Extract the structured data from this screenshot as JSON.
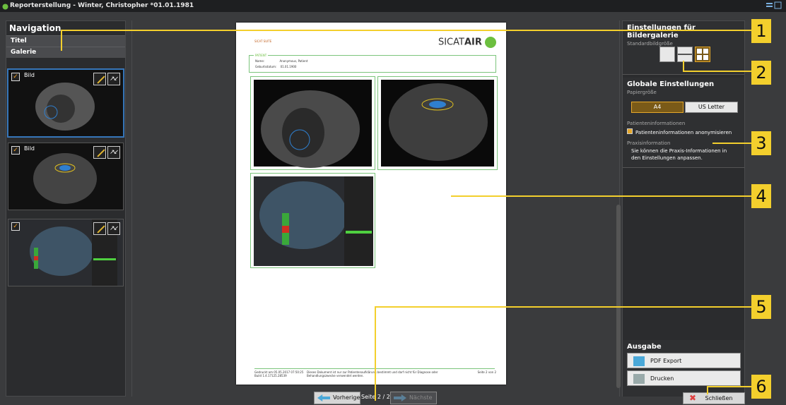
{
  "window": {
    "title": "Reporterstellung - Winter, Christopher *01.01.1981"
  },
  "navigation": {
    "title": "Navigation",
    "sections": [
      "Titel",
      "Galerie"
    ],
    "thumbnails": [
      {
        "label": "Bild",
        "checked": true,
        "selected": true
      },
      {
        "label": "Bild",
        "checked": true,
        "selected": false
      },
      {
        "label": "",
        "checked": true,
        "selected": false
      }
    ]
  },
  "document": {
    "brand_small": "SICAT SUITE",
    "brand": "SICAT",
    "brand_bold": "AIR",
    "patient_header": "PATIENT",
    "name_label": "Name:",
    "name_value": "Anonymous, Patient",
    "dob_label": "Geburtsdatum:",
    "dob_value": "01.01.1900",
    "footer_left": "Gedruckt am 05.05.2017 07:50:25\nBuild 1.4.17125.28539",
    "footer_mid": "Dieses Dokument ist nur zur Patientenaufklärung bestimmt und darf nicht für Diagnose oder Behandlungszwecke verwendet werden.",
    "footer_right": "Seite 2 von 2"
  },
  "pager": {
    "prev": "Vorherige",
    "page": "Seite 2 / 2",
    "next": "Nächste"
  },
  "gallery_settings": {
    "title": "Einstellungen für Bildergalerie",
    "subtitle": "Standardbildgröße",
    "sizes": [
      "single",
      "half",
      "quarter"
    ],
    "selected": 2
  },
  "global_settings": {
    "title": "Globale Einstellungen",
    "paper_label": "Papiergröße",
    "paper_options": [
      "A4",
      "US Letter"
    ],
    "paper_selected": "A4",
    "patient_info_label": "Patienteninformationen",
    "anonymize_label": "Patienteninformationen anonymisieren",
    "anonymize_checked": true,
    "practice_label": "Praxisinformation",
    "practice_text": "Sie können die Praxis-Informationen in den Einstellungen anpassen."
  },
  "output": {
    "title": "Ausgabe",
    "pdf_label": "PDF Export",
    "print_label": "Drucken"
  },
  "close_label": "Schließen",
  "callouts": [
    "1",
    "2",
    "3",
    "4",
    "5",
    "6"
  ],
  "colors": {
    "accent": "#f3cf2d",
    "green": "#6cbf3f",
    "selected": "#e6a82a"
  }
}
